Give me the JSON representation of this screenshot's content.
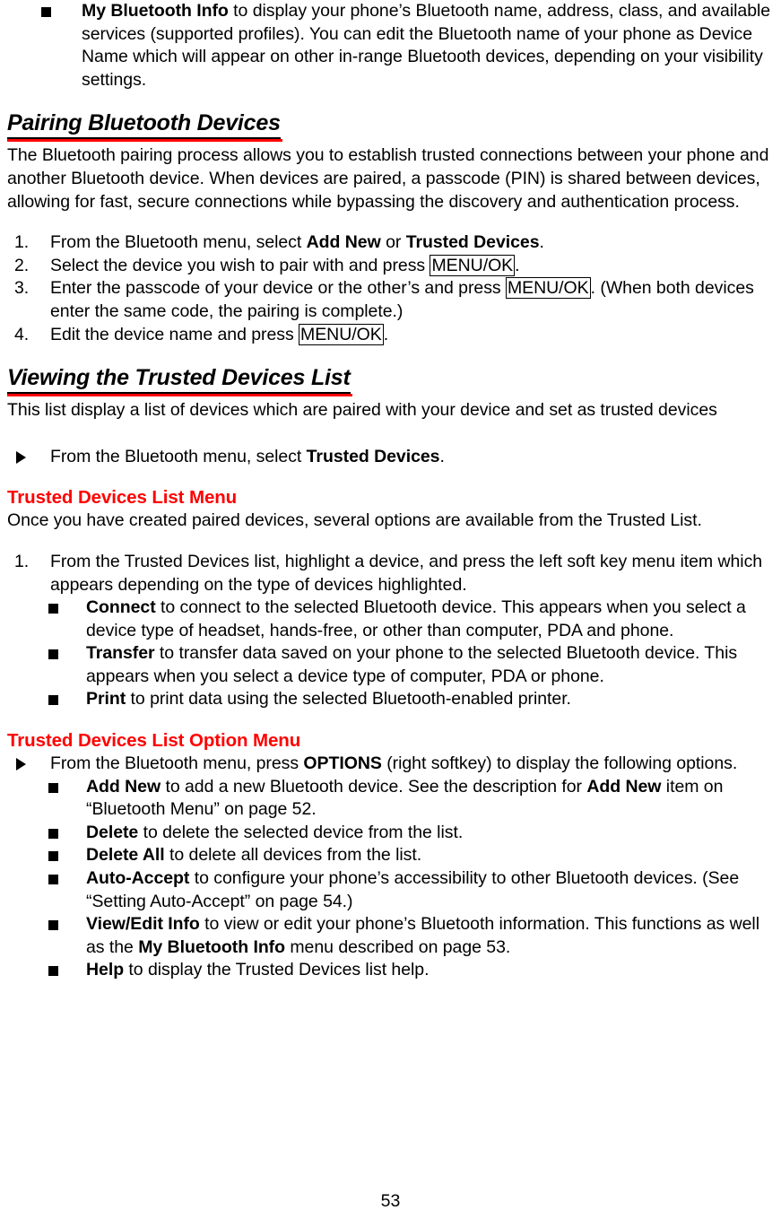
{
  "document": {
    "page_number": "53",
    "colors": {
      "heading_rule": "#ff0000",
      "sub_heading": "#ff0000",
      "body_text": "#000000"
    }
  },
  "top_bullet": {
    "term": "My Bluetooth Info",
    "text": " to display your phone’s Bluetooth name, address, class, and available services (supported profiles). You can edit the Bluetooth name of your phone as Device Name which will appear on other in-range Bluetooth devices, depending on your visibility settings."
  },
  "pairing_section": {
    "heading": "Pairing Bluetooth Devices",
    "intro": "The Bluetooth pairing process allows you to establish trusted connections between your phone and another Bluetooth device. When devices are paired, a passcode (PIN) is shared between devices, allowing for fast, secure connections while bypassing the discovery and authentication process.",
    "steps": [
      {
        "number": "1.",
        "pre": "From the Bluetooth menu, select ",
        "bold1": "Add New",
        "mid": " or ",
        "bold2": "Trusted Devices",
        "post": "."
      },
      {
        "number": "2.",
        "pre": "Select the device you wish to pair with and press ",
        "key": "MENU/OK",
        "post": "."
      },
      {
        "number": "3.",
        "pre": "Enter the passcode of your device or the other’s and press ",
        "key": "MENU/OK",
        "post": ". (When both devices enter the same code, the pairing is complete.)"
      },
      {
        "number": "4.",
        "pre": "Edit the device name and press ",
        "key": "MENU/OK",
        "post": "."
      }
    ]
  },
  "viewing_section": {
    "heading": "Viewing the Trusted Devices List",
    "intro": "This list display a list of devices which are paired with your device and set as trusted devices",
    "action": {
      "pre": "From the Bluetooth menu, select ",
      "bold": "Trusted Devices",
      "post": "."
    }
  },
  "list_menu_section": {
    "heading": "Trusted Devices List Menu",
    "intro": "Once you have created paired devices, several options are available from the Trusted List.",
    "step": {
      "number": "1.",
      "text": "From the Trusted Devices list, highlight a device, and press the left soft key menu item which appears depending on the type of devices highlighted."
    },
    "items": [
      {
        "term": "Connect",
        "text": " to connect to the selected Bluetooth device. This appears when you select a device type of headset, hands-free, or other than computer, PDA and phone."
      },
      {
        "term": "Transfer",
        "text": " to transfer data saved on your phone to the selected Bluetooth device. This appears when you select a device type of computer, PDA or phone."
      },
      {
        "term": "Print",
        "text": " to print data using the selected Bluetooth-enabled printer."
      }
    ]
  },
  "option_menu_section": {
    "heading": "Trusted Devices List Option Menu",
    "action": {
      "pre": "From the Bluetooth menu, press ",
      "bold": "OPTIONS",
      "post": " (right softkey) to display the following options."
    },
    "items": [
      {
        "term": "Add New",
        "text": " to add a new Bluetooth device. See the description for ",
        "term2": "Add New",
        "text2": " item on “Bluetooth Menu” on page 52."
      },
      {
        "term": "Delete",
        "text": " to delete the selected device from the list."
      },
      {
        "term": "Delete All",
        "text": " to delete all devices from the list."
      },
      {
        "term": "Auto-Accept",
        "text": " to configure your phone’s accessibility to other Bluetooth devices. (See “Setting Auto-Accept” on page 54.)"
      },
      {
        "term": "View/Edit Info",
        "text": " to view or edit your phone’s Bluetooth information. This functions as well as the ",
        "term2": "My Bluetooth Info",
        "text2": " menu described on page 53."
      },
      {
        "term": "Help",
        "text": " to display the Trusted Devices list help."
      }
    ]
  }
}
